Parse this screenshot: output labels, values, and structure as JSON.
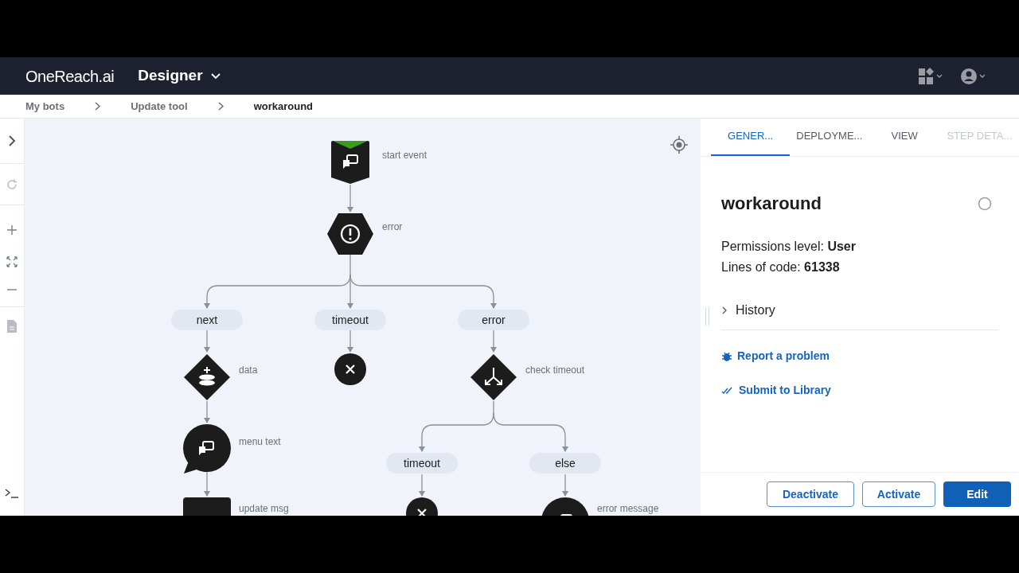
{
  "header": {
    "logo": "OneReach.ai",
    "app": "Designer"
  },
  "breadcrumbs": [
    {
      "label": "My bots",
      "current": false
    },
    {
      "label": "Update tool",
      "current": false
    },
    {
      "label": "workaround",
      "current": true
    }
  ],
  "flow": {
    "nodes": [
      {
        "kind": "start",
        "label": "start event"
      },
      {
        "kind": "error",
        "label": "error"
      },
      {
        "kind": "data",
        "label": "data"
      },
      {
        "kind": "end"
      },
      {
        "kind": "condition",
        "label": "check timeout"
      },
      {
        "kind": "message",
        "label": "menu text"
      },
      {
        "kind": "end"
      },
      {
        "kind": "message",
        "label": "error message"
      },
      {
        "kind": "update",
        "label": "update msg"
      }
    ],
    "exits": [
      "next",
      "timeout",
      "error",
      "timeout",
      "else"
    ]
  },
  "panel": {
    "tabs": [
      {
        "label": "GENER...",
        "selected": true,
        "disabled": false
      },
      {
        "label": "DEPLOYME...",
        "selected": false,
        "disabled": false
      },
      {
        "label": "VIEW",
        "selected": false,
        "disabled": false
      },
      {
        "label": "STEP DETA...",
        "selected": false,
        "disabled": true
      }
    ],
    "title": "workaround",
    "details": [
      "Permissions level: **User**",
      "Lines of code: **61338**"
    ],
    "history": {
      "label": "History",
      "expanded": false
    },
    "links": [
      {
        "kind": "report",
        "label": "Report a problem"
      },
      {
        "kind": "submit",
        "label": "Submit to Library"
      }
    ],
    "buttons": [
      {
        "label": "Deactivate",
        "kind": "outline"
      },
      {
        "label": "Activate",
        "kind": "outline"
      },
      {
        "label": "Edit",
        "kind": "primary"
      }
    ]
  }
}
